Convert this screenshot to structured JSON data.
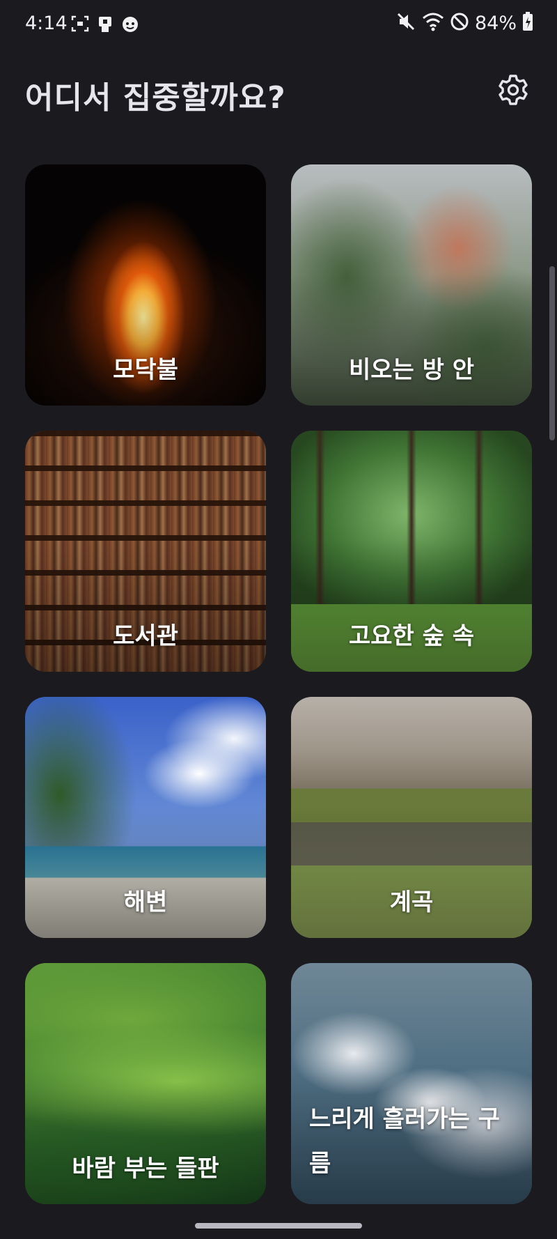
{
  "status_bar": {
    "time": "4:14",
    "battery": "84%",
    "left_icons": [
      "screenshot-icon",
      "device-icon",
      "face-icon"
    ],
    "right_icons": [
      "mute-icon",
      "wifi-icon",
      "do-not-disturb-icon",
      "battery-icon"
    ]
  },
  "header": {
    "title": "어디서 집중할까요?",
    "settings_icon": "gear-icon"
  },
  "places": [
    {
      "label": "모닥불",
      "scene": "campfire"
    },
    {
      "label": "비오는 방 안",
      "scene": "rain-window"
    },
    {
      "label": "도서관",
      "scene": "library"
    },
    {
      "label": "고요한 숲 속",
      "scene": "forest"
    },
    {
      "label": "해변",
      "scene": "beach"
    },
    {
      "label": "계곡",
      "scene": "creek"
    },
    {
      "label": "바람 부는 들판",
      "scene": "hills"
    },
    {
      "label": "느리게 흘러가는 구름",
      "scene": "clouds"
    }
  ],
  "colors": {
    "background": "#1b1a1f",
    "title_text": "#e6e5ec",
    "label_text": "#ffffff"
  }
}
